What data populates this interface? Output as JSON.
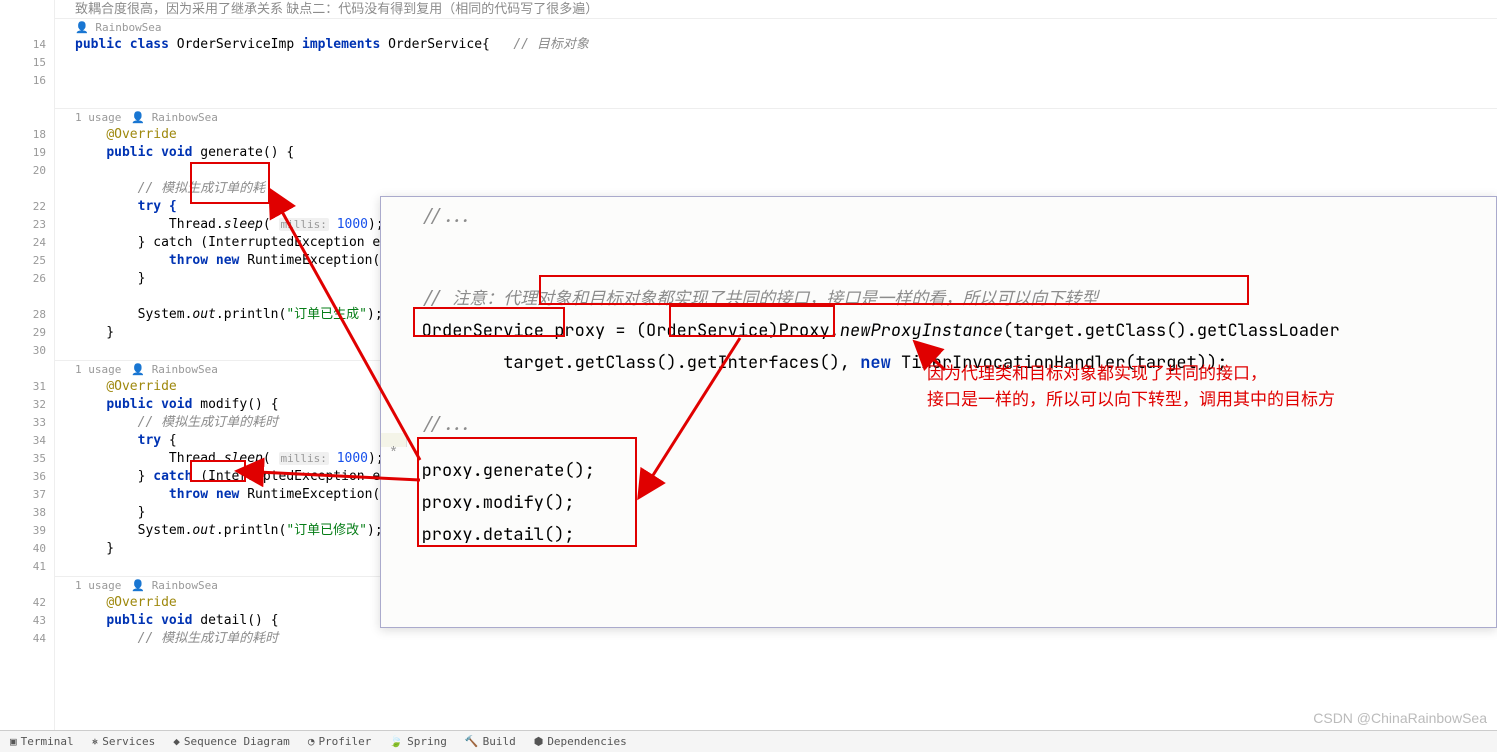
{
  "gutter": [
    "",
    "",
    "14",
    "15",
    "16",
    "",
    "",
    "18",
    "19",
    "20",
    "",
    "22",
    "23",
    "24",
    "25",
    "26",
    "",
    "28",
    "29",
    "30",
    "",
    "31",
    "32",
    "33",
    "34",
    "35",
    "36",
    "37",
    "38",
    "39",
    "40",
    "41",
    "",
    "42",
    "43",
    "44"
  ],
  "top_comment_line1": "致耦合度很高，因为采用了继承关系 缺点二：代码没有得到复用（相同的代码写了很多遍）",
  "author1": "RainbowSea",
  "class_decl": {
    "public": "public",
    "class": "class",
    "name": "OrderServiceImp",
    "implements": "implements",
    "iface": "OrderService",
    "cmt": "// 目标对象"
  },
  "usage_hdr": {
    "usage": "1 usage",
    "author": "RainbowSea"
  },
  "override": "@Override",
  "m1": {
    "sig_pre": "public void ",
    "name": "generate",
    "sig_post": "() {",
    "cmt1": "// 模拟生成订单的耗",
    "try": "try {",
    "sleep_pre": "Thread.",
    "sleep_fn": "sleep",
    "sleep_hint": "millis:",
    "sleep_arg": "1000",
    "catch": "} catch (InterruptedException e) {",
    "throw": "throw new RuntimeException(e);",
    "close_catch": "}",
    "out_pre": "System.",
    "out_field": "out",
    "out_fn": ".println(",
    "out_str": "\"订单已生成\"",
    "out_post": ");"
  },
  "m2": {
    "name": "modify",
    "cmt1": "// 模拟生成订单的耗时",
    "out_str": "\"订单已修改\""
  },
  "m3": {
    "name": "detail",
    "cmt1": "// 模拟生成订单的耗时"
  },
  "overlay": {
    "dots": "//...",
    "note_prefix": "// 注意：",
    "note_body": "代理对象和目标对象都实现了共同的接口，接口是一样的看，所以可以向下转型",
    "cast_type": "OrderService",
    "proxy_var": " proxy = ",
    "cast_open": "(OrderService)",
    "proxy_cls": "Proxy",
    "proxy_fn": ".newProxyInstance",
    "proxy_args1": "(target.getClass().getClassLoader",
    "line2_pre": "target.getClass().getInterfaces()",
    "line2_comma": ", ",
    "new_kw": "new",
    "handler": " TimerInvocationHandler(target));",
    "dots2": "//...",
    "gutter_mark": "*",
    "call1": "proxy.generate();",
    "call2": "proxy.modify();",
    "call3": "proxy.detail();",
    "redline1": "因为代理类和目标对象都实现了共同的接口，",
    "redline2": "接口是一样的，所以可以向下转型，调用其中的目标方"
  },
  "bottom_tabs": [
    "Terminal",
    "Services",
    "Sequence Diagram",
    "Profiler",
    "Spring",
    "Build",
    "Dependencies"
  ],
  "watermark": "CSDN @ChinaRainbowSea"
}
